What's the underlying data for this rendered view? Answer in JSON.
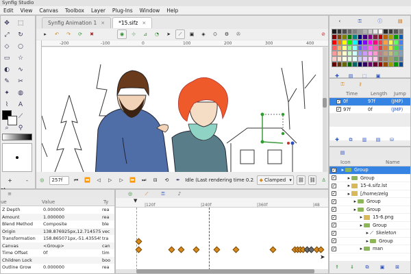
{
  "window": {
    "title": "Synfig Studio"
  },
  "menu": [
    "Edit",
    "View",
    "Canvas",
    "Toolbox",
    "Layer",
    "Plug-Ins",
    "Window",
    "Help"
  ],
  "tabs": [
    {
      "label": "Synfig Animation 1",
      "active": false
    },
    {
      "label": "*15.sifz",
      "active": true
    }
  ],
  "ruler": {
    "ticks": [
      "-200",
      "-100",
      "0",
      "100",
      "200",
      "300",
      "400"
    ]
  },
  "canvas_bar": {
    "frame": "257f",
    "status": "Idle (Last rendering time 0.2...",
    "interpolation": "Clamped"
  },
  "params": {
    "headers": {
      "name": "ue",
      "value": "Value",
      "type": "Ty"
    },
    "rows": [
      {
        "name": "Z Depth",
        "value": "0.000000",
        "type": "rea"
      },
      {
        "name": "Amount",
        "value": "1.000000",
        "type": "rea"
      },
      {
        "name": "Blend Method",
        "value": "Composite",
        "type": "ble"
      },
      {
        "name": "Origin",
        "value": "138.876925px,12.714575",
        "type": "vec"
      },
      {
        "name": "Transformation",
        "value": "158.865071px,-51.435545",
        "type": "tra"
      },
      {
        "name": "Canvas",
        "value": "<Group>",
        "type": "can"
      },
      {
        "name": "Time Offset",
        "value": "0f",
        "type": "tim"
      },
      {
        "name": "Children Lock",
        "value": "",
        "type": "boo"
      },
      {
        "name": "Outline Grow",
        "value": "0.000000",
        "type": "rea"
      }
    ]
  },
  "timeline": {
    "ticks": [
      "|120f",
      "|240f",
      "|360f",
      "|48"
    ]
  },
  "waypoints": {
    "headers": {
      "time": "Time",
      "length": "Length",
      "jump": "Jump"
    },
    "rows": [
      {
        "time": "0f",
        "length": "97f",
        "jump": "(JMP)",
        "selected": true
      },
      {
        "time": "97f",
        "length": "0f",
        "jump": "(JMP)",
        "selected": false
      }
    ]
  },
  "layers": {
    "headers": {
      "icon": "Icon",
      "name": "Name"
    },
    "rows": [
      {
        "name": "Group",
        "indent": 0,
        "selected": true
      },
      {
        "name": "Group",
        "indent": 1,
        "selected": false
      },
      {
        "name": "15-4.sifz.lst",
        "indent": 1,
        "selected": false
      },
      {
        "name": "[/home/zelg",
        "indent": 1,
        "selected": false
      },
      {
        "name": "Group",
        "indent": 2,
        "selected": false
      },
      {
        "name": "Group",
        "indent": 2,
        "selected": false
      },
      {
        "name": "15-6.png",
        "indent": 3,
        "selected": false
      },
      {
        "name": "Group",
        "indent": 3,
        "selected": false
      },
      {
        "name": "Skeleton",
        "indent": 4,
        "selected": false
      },
      {
        "name": "Group",
        "indent": 4,
        "selected": false
      },
      {
        "name": "man",
        "indent": 3,
        "selected": false
      }
    ]
  },
  "palette": {
    "colors": [
      "#1a1a1a",
      "#333333",
      "#4d4d4d",
      "#666666",
      "#808080",
      "#999999",
      "#b3b3b3",
      "#cccccc",
      "#e6e6e6",
      "#ffffff",
      "#2a2a2a",
      "#3c3c3c",
      "#555555",
      "#777777",
      "#800000",
      "#804000",
      "#808000",
      "#008000",
      "#008080",
      "#000080",
      "#400080",
      "#800080",
      "#802040",
      "#c00000",
      "#c06000",
      "#a0a000",
      "#00a000",
      "#0060c0",
      "#ff0000",
      "#ff8000",
      "#ffff00",
      "#00ff00",
      "#00ffff",
      "#0000ff",
      "#8000ff",
      "#ff00ff",
      "#ff0080",
      "#ff4040",
      "#ffa040",
      "#ffff60",
      "#60ff60",
      "#4080ff",
      "#ff6060",
      "#ffb060",
      "#ffff90",
      "#90ff90",
      "#90ffff",
      "#6060ff",
      "#b060ff",
      "#ff60ff",
      "#ff60b0",
      "#e04040",
      "#e08040",
      "#e0e040",
      "#40e040",
      "#40a0e0",
      "#ff9999",
      "#ffcc99",
      "#ffffcc",
      "#ccffcc",
      "#ccffff",
      "#9999ff",
      "#cc99ff",
      "#ff99ff",
      "#ff99cc",
      "#c08080",
      "#c0a080",
      "#c0c080",
      "#80c080",
      "#80a0c0",
      "#ffcccc",
      "#ffe6cc",
      "#ffffe6",
      "#e6ffe6",
      "#e6ffff",
      "#ccccff",
      "#e6ccff",
      "#ffccff",
      "#ffcce6",
      "#a06060",
      "#a08060",
      "#a0a060",
      "#60a060",
      "#6080a0",
      "#660000",
      "#663300",
      "#666600",
      "#006600",
      "#006666",
      "#000066",
      "#330066",
      "#660066",
      "#660033",
      "#990000",
      "#994c00",
      "#999900",
      "#009900",
      "#004c99"
    ]
  }
}
